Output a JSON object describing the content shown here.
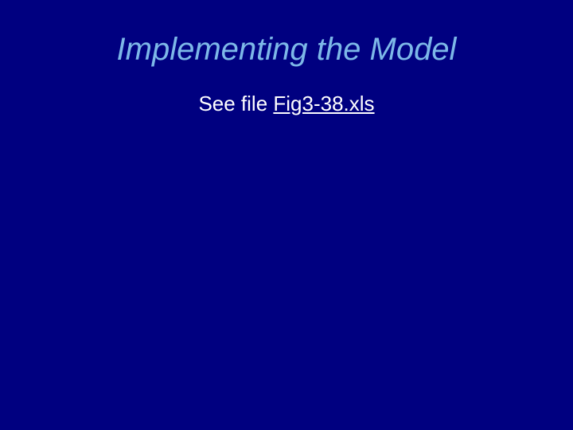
{
  "slide": {
    "title": "Implementing the Model",
    "body_prefix": "See file ",
    "link_text": "Fig3-38.xls"
  }
}
